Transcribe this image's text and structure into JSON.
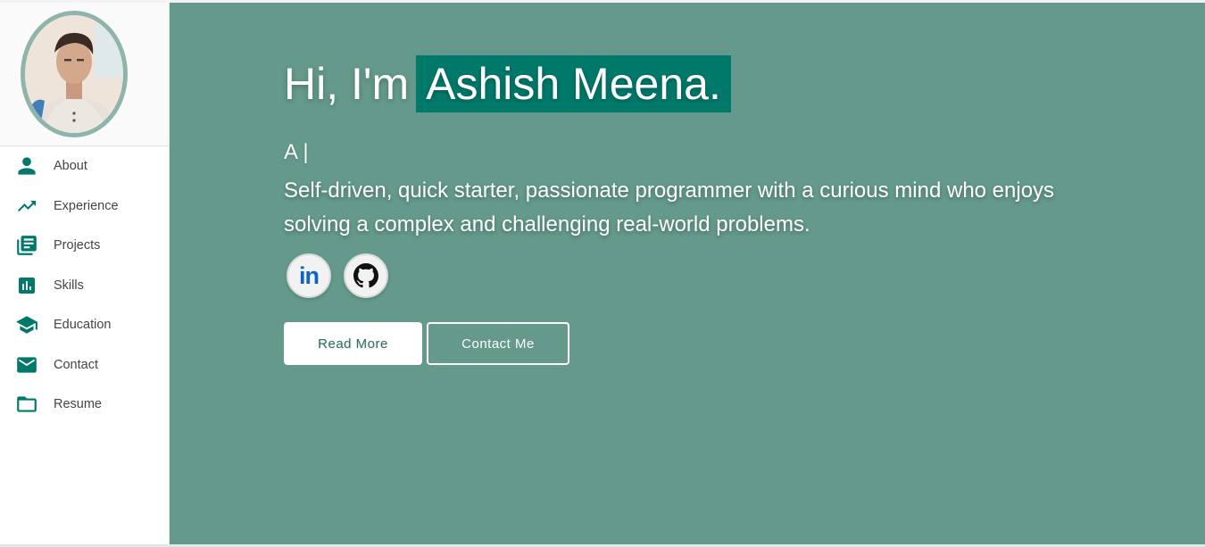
{
  "sidebar": {
    "avatar_alt": "Profile photo",
    "items": [
      {
        "label": "About",
        "icon": "person-icon"
      },
      {
        "label": "Experience",
        "icon": "trending-up-icon"
      },
      {
        "label": "Projects",
        "icon": "library-books-icon"
      },
      {
        "label": "Skills",
        "icon": "bar-chart-icon"
      },
      {
        "label": "Education",
        "icon": "graduation-cap-icon"
      },
      {
        "label": "Contact",
        "icon": "mail-icon"
      },
      {
        "label": "Resume",
        "icon": "folder-icon"
      }
    ]
  },
  "hero": {
    "greeting": "Hi, I'm",
    "name": "Ashish Meena.",
    "typed": "A |",
    "bio": "Self-driven, quick starter, passionate programmer with a curious mind who enjoys solving a complex and challenging real-world problems."
  },
  "socials": [
    {
      "label": "in",
      "icon": "linkedin-icon"
    },
    {
      "icon": "github-icon"
    }
  ],
  "buttons": {
    "read_more": "Read More",
    "contact": "Contact Me"
  },
  "colors": {
    "accent": "#00796b",
    "main_bg": "#64998b",
    "icon": "#00796b"
  }
}
